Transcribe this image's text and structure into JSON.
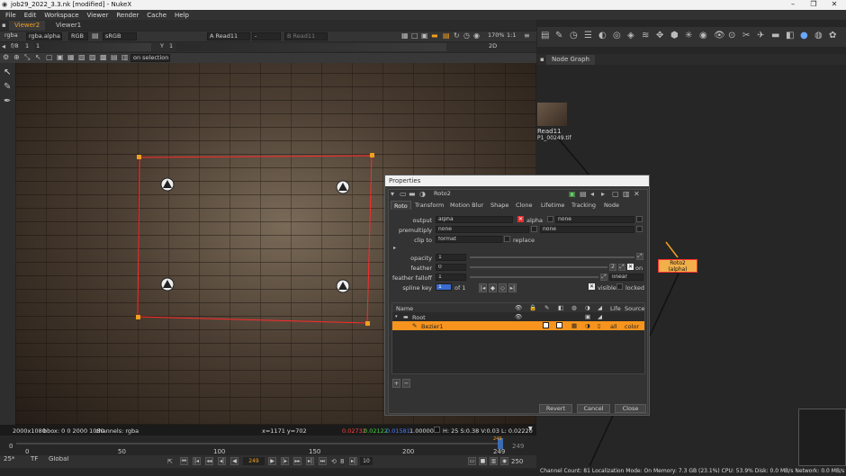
{
  "window": {
    "title": "job29_2022_3.3.nk [modified] - NukeX",
    "controls": [
      "–",
      "❐",
      "✕"
    ]
  },
  "menu": [
    "File",
    "Edit",
    "Workspace",
    "Viewer",
    "Render",
    "Cache",
    "Help"
  ],
  "viewer_tabs": [
    "Viewer2",
    "Viewer1"
  ],
  "viewer_toolbar1": {
    "channels": "rgba",
    "channel_alpha": "rgba.alpha",
    "rgb": "RGB",
    "colorspace": "sRGB",
    "input_a_label": "A",
    "input_a": "Read11",
    "wipe": "-",
    "input_b_label": "B",
    "input_b": "Read11",
    "zoom": "170%",
    "ratio": "1:1"
  },
  "viewer_toolbar2": {
    "fstop": "f/8",
    "frame_prefix": "1",
    "gain": "1",
    "gamma_label": "Y",
    "gamma": "1",
    "view": "2D"
  },
  "viewer_toolbar3": {
    "on_selection": "on selection"
  },
  "infobar": {
    "format": "2000x1080",
    "bbox": "bbox: 0 0 2000 1080",
    "channels": "channels: rgba",
    "coords": "x=1171 y=702",
    "r": "0.02732",
    "g": "0.02122",
    "b": "0.01581",
    "a": "1.00000",
    "hsvl": "H: 25 S:0.38 V:0.03 L: 0.02220"
  },
  "timeline": {
    "ticks": [
      "0",
      "50",
      "100",
      "150",
      "200",
      "249"
    ],
    "current": "249",
    "left_val": "0",
    "right_val": "249",
    "fps": "25*",
    "tf": "TF",
    "scope": "Global",
    "frame": "249",
    "step": "10",
    "end": "250",
    "inc": "8"
  },
  "nodegraph": {
    "tab": "Node Graph",
    "read_node": "Read11",
    "read_sub": "P1_00249.tif",
    "roto_node": "Roto2",
    "roto_sub": "(alpha)"
  },
  "status": "Channel Count: 81  Localization Mode: On  Memory: 7.3 GB (23.1%)  CPU: 53.9%  Disk: 0.0 MB/s  Network: 0.0 MB/s",
  "properties": {
    "title": "Properties",
    "node_name": "Roto2",
    "tabs": [
      "Roto",
      "Transform",
      "Motion Blur",
      "Shape",
      "Clone",
      "Lifetime",
      "Tracking",
      "Node"
    ],
    "output_label": "output",
    "output": "alpha",
    "output_alpha": "alpha",
    "output_none": "none",
    "premult_label": "premultiply",
    "premult": "none",
    "premult_none": "none",
    "clip_label": "clip to",
    "clip": "format",
    "replace": "replace",
    "opacity_label": "opacity",
    "opacity": "1",
    "feather_label": "feather",
    "feather": "0",
    "feather_count": "2",
    "feather_on": "on",
    "falloff_label": "feather falloff",
    "falloff": "1",
    "falloff_mode": "linear",
    "spline_label": "spline key",
    "spline_key": "1",
    "spline_of": "of 1",
    "visible": "visible",
    "locked": "locked",
    "list_headers": {
      "name": "Name",
      "life": "Life",
      "source": "Source"
    },
    "root": "Root",
    "item": {
      "name": "Bezier1",
      "life": "all",
      "source": "color"
    },
    "buttons": {
      "revert": "Revert",
      "cancel": "Cancel",
      "close": "Close"
    }
  },
  "colors": {
    "accent": "#f0a020",
    "selection": "#f7941d",
    "roto_line": "#ff2a2a",
    "roto_node": "#f2b04a"
  }
}
